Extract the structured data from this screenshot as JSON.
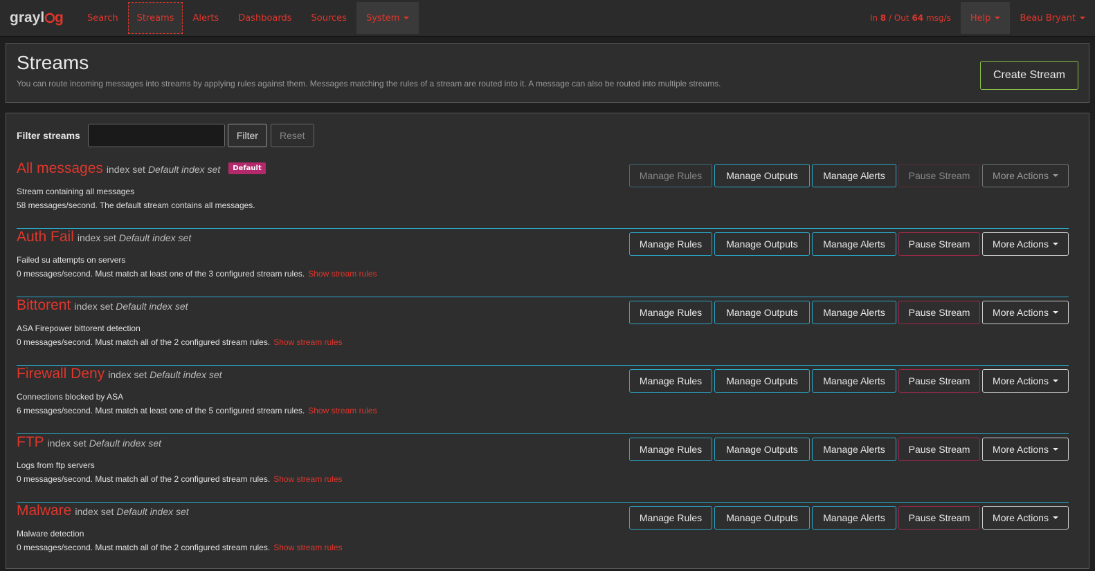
{
  "nav": {
    "brand": "graylog",
    "items": [
      {
        "label": "Search"
      },
      {
        "label": "Streams"
      },
      {
        "label": "Alerts"
      },
      {
        "label": "Dashboards"
      },
      {
        "label": "Sources"
      },
      {
        "label": "System"
      }
    ],
    "throughput": {
      "in_label": "In",
      "in_value": "8",
      "separator": "/",
      "out_label": "Out",
      "out_value": "64",
      "unit": "msg/s"
    },
    "help": "Help",
    "user": "Beau Bryant"
  },
  "header": {
    "title": "Streams",
    "description": "You can route incoming messages into streams by applying rules against them. Messages matching the rules of a stream are routed into it. A message can also be routed into multiple streams.",
    "create_button": "Create Stream"
  },
  "filter": {
    "label": "Filter streams",
    "value": "",
    "filter_button": "Filter",
    "reset_button": "Reset"
  },
  "labels": {
    "index_set": "index set",
    "manage_rules": "Manage Rules",
    "manage_outputs": "Manage Outputs",
    "manage_alerts": "Manage Alerts",
    "pause_stream": "Pause Stream",
    "more_actions": "More Actions",
    "show_rules": "Show stream rules"
  },
  "streams": [
    {
      "title": "All messages",
      "index_set": "Default index set",
      "badge": "Default",
      "description": "Stream containing all messages",
      "stats": "58 messages/second. The default stream contains all messages.",
      "show_rules": ""
    },
    {
      "title": "Auth Fail",
      "index_set": "Default index set",
      "badge": "",
      "description": "Failed su attempts on servers",
      "stats": "0 messages/second. Must match at least one of the 3 configured stream rules.",
      "show_rules": "Show stream rules"
    },
    {
      "title": "Bittorent",
      "index_set": "Default index set",
      "badge": "",
      "description": "ASA Firepower bittorent detection",
      "stats": "0 messages/second. Must match all of the 2 configured stream rules.",
      "show_rules": "Show stream rules"
    },
    {
      "title": "Firewall Deny",
      "index_set": "Default index set",
      "badge": "",
      "description": "Connections blocked by ASA",
      "stats": "6 messages/second. Must match at least one of the 5 configured stream rules.",
      "show_rules": "Show stream rules"
    },
    {
      "title": "FTP",
      "index_set": "Default index set",
      "badge": "",
      "description": "Logs from ftp servers",
      "stats": "0 messages/second. Must match all of the 2 configured stream rules.",
      "show_rules": "Show stream rules"
    },
    {
      "title": "Malware",
      "index_set": "Default index set",
      "badge": "",
      "description": "Malware detection",
      "stats": "0 messages/second. Must match all of the 2 configured stream rules.",
      "show_rules": "Show stream rules"
    }
  ],
  "colors": {
    "accent": "#e0362c",
    "info": "#2aa8c9",
    "danger": "#a3284b",
    "badge": "#b3296c",
    "success": "#8bc34a"
  }
}
